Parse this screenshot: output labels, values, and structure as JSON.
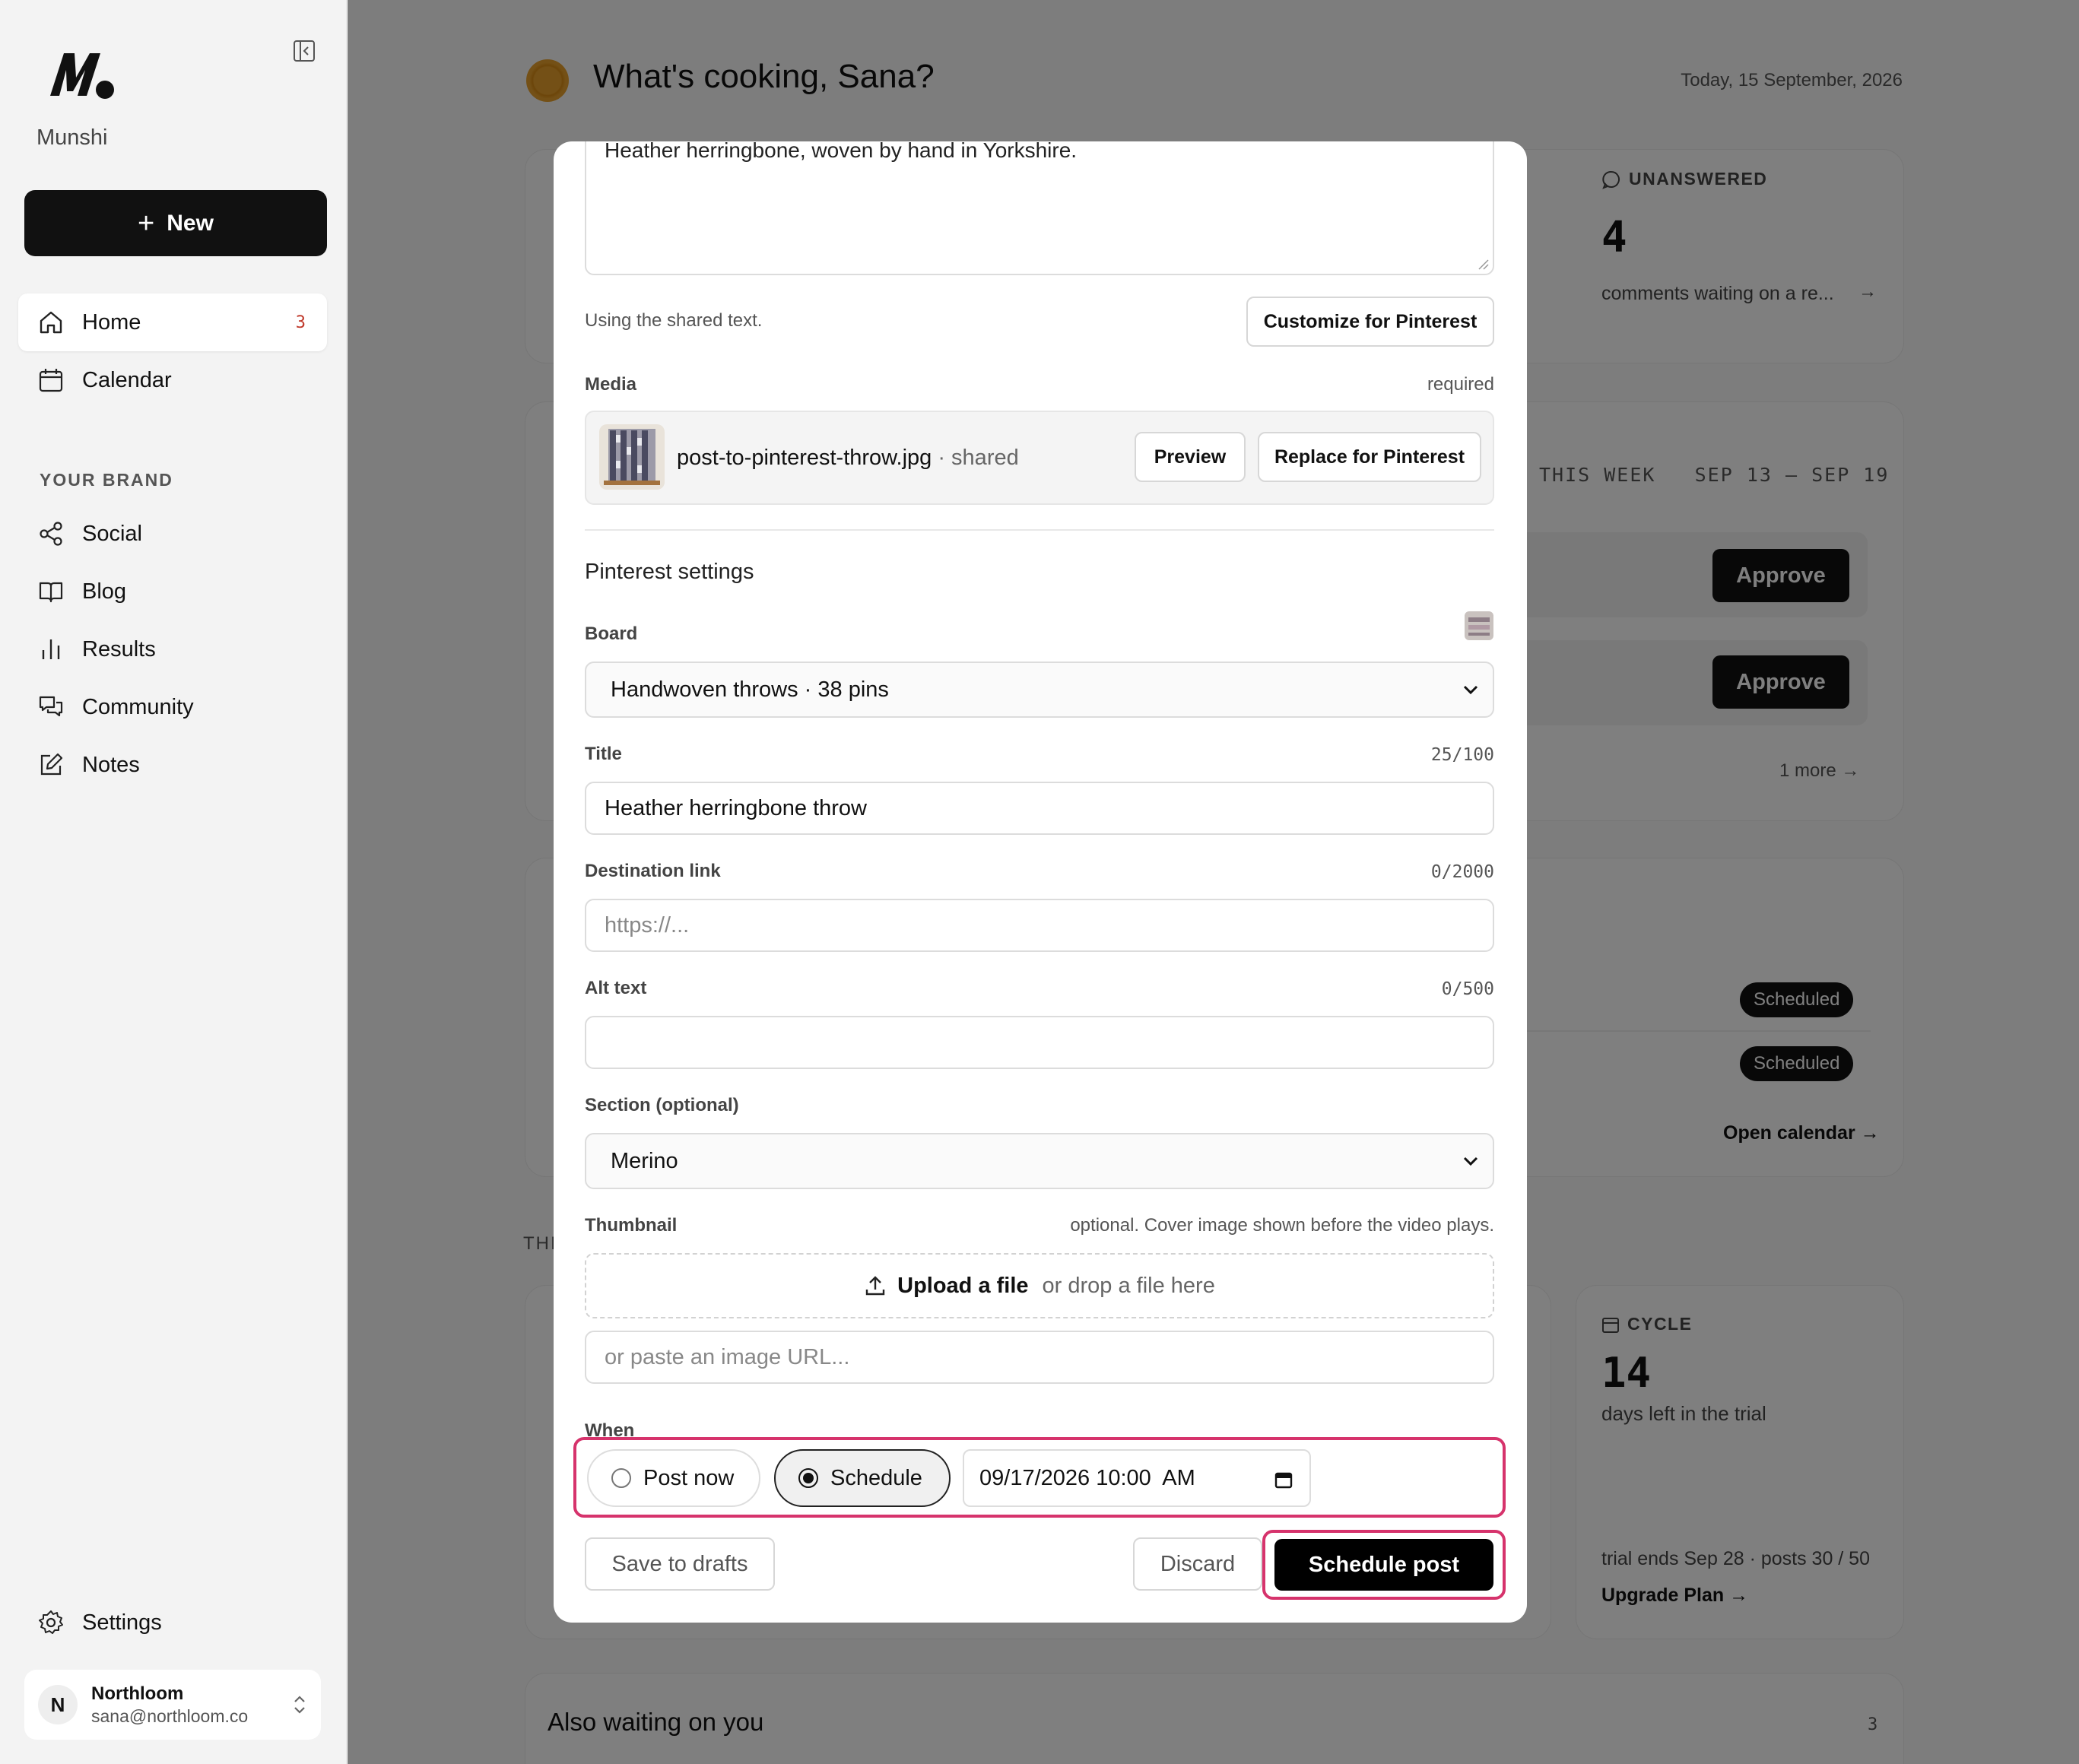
{
  "sidebar": {
    "brand": "Munshi",
    "new_label": "New",
    "section_label": "YOUR BRAND",
    "items": [
      {
        "label": "Home",
        "badge": "3"
      },
      {
        "label": "Calendar"
      },
      {
        "label": "Social"
      },
      {
        "label": "Blog"
      },
      {
        "label": "Results"
      },
      {
        "label": "Community"
      },
      {
        "label": "Notes"
      }
    ],
    "settings_label": "Settings",
    "account": {
      "initial": "N",
      "name": "Northloom",
      "email": "sana@northloom.co"
    }
  },
  "main": {
    "greeting": "What's cooking, Sana?",
    "date": "Today, 15 September, 2026",
    "unanswered": {
      "label": "UNANSWERED",
      "value": "4",
      "desc": "comments waiting on a re..."
    },
    "week": {
      "label": "THIS WEEK",
      "range": "SEP 13 – SEP 19",
      "approve": "Approve",
      "more": "1 more"
    },
    "scheduled": {
      "pill": "Scheduled",
      "open_calendar": "Open calendar →"
    },
    "section_fragment": "THI",
    "cycle": {
      "label": "CYCLE",
      "value": "14",
      "desc": "days left in the trial",
      "foot": "trial ends Sep 28 · posts 30 / 50",
      "upgrade": "Upgrade Plan →"
    },
    "waiting": {
      "title": "Also waiting on you",
      "count": "3"
    }
  },
  "modal": {
    "text_value": "Heather herringbone, woven by hand in Yorkshire.",
    "shared_note": "Using the shared text.",
    "customize_label": "Customize for Pinterest",
    "media_label": "Media",
    "media_required": "required",
    "media_file": "post-to-pinterest-throw.jpg",
    "media_shared": "· shared",
    "preview_label": "Preview",
    "replace_label": "Replace for Pinterest",
    "settings_title": "Pinterest settings",
    "board_label": "Board",
    "board_value": "Handwoven throws · 38 pins",
    "title_label": "Title",
    "title_counter": "25/100",
    "title_value": "Heather herringbone throw",
    "link_label": "Destination link",
    "link_counter": "0/2000",
    "link_placeholder": "https://...",
    "alt_label": "Alt text",
    "alt_counter": "0/500",
    "alt_value": "",
    "section_label": "Section (optional)",
    "section_value": "Merino",
    "thumb_label": "Thumbnail",
    "thumb_note": "optional. Cover image shown before the video plays.",
    "upload_label": "Upload a file",
    "drop_label": "or drop a file here",
    "url_placeholder": "or paste an image URL...",
    "when_label": "When",
    "post_now_label": "Post now",
    "schedule_label": "Schedule",
    "datetime_value": "09/17/2026 10:00  AM",
    "drafts_label": "Save to drafts",
    "discard_label": "Discard",
    "schedule_post_label": "Schedule post"
  },
  "colors": {
    "accent": "#111111",
    "highlight": "#d6336c",
    "badge": "#c0392b"
  }
}
